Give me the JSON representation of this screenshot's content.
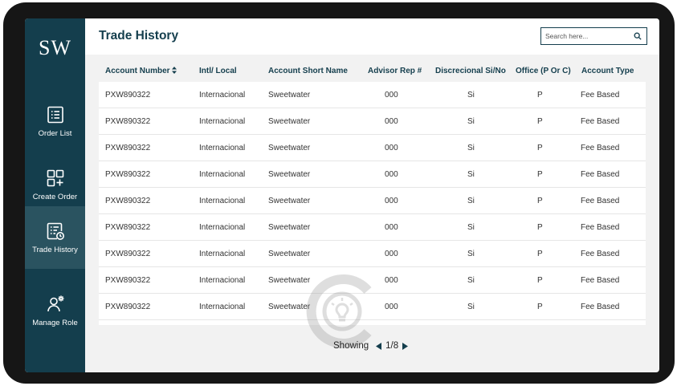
{
  "app": {
    "logo": "SW"
  },
  "sidebar": {
    "items": [
      {
        "label": "Order List",
        "icon": "list-icon",
        "active": false
      },
      {
        "label": "Create Order",
        "icon": "grid-plus-icon",
        "active": false
      },
      {
        "label": "Trade History",
        "icon": "history-list-icon",
        "active": true
      },
      {
        "label": "Manage Role",
        "icon": "user-gear-icon",
        "active": false
      }
    ]
  },
  "header": {
    "title": "Trade History",
    "search_placeholder": "Search here..."
  },
  "table": {
    "columns": [
      "Account Number",
      "Intl/ Local",
      "Account Short Name",
      "Advisor Rep #",
      "Discrecional Si/No",
      "Office (P Or C)",
      "Account Type"
    ],
    "rows": [
      [
        "PXW890322",
        "Internacional",
        "Sweetwater",
        "000",
        "Si",
        "P",
        "Fee Based"
      ],
      [
        "PXW890322",
        "Internacional",
        "Sweetwater",
        "000",
        "Si",
        "P",
        "Fee Based"
      ],
      [
        "PXW890322",
        "Internacional",
        "Sweetwater",
        "000",
        "Si",
        "P",
        "Fee Based"
      ],
      [
        "PXW890322",
        "Internacional",
        "Sweetwater",
        "000",
        "Si",
        "P",
        "Fee Based"
      ],
      [
        "PXW890322",
        "Internacional",
        "Sweetwater",
        "000",
        "Si",
        "P",
        "Fee Based"
      ],
      [
        "PXW890322",
        "Internacional",
        "Sweetwater",
        "000",
        "Si",
        "P",
        "Fee Based"
      ],
      [
        "PXW890322",
        "Internacional",
        "Sweetwater",
        "000",
        "Si",
        "P",
        "Fee Based"
      ],
      [
        "PXW890322",
        "Internacional",
        "Sweetwater",
        "000",
        "Si",
        "P",
        "Fee Based"
      ],
      [
        "PXW890322",
        "Internacional",
        "Sweetwater",
        "000",
        "Si",
        "P",
        "Fee Based"
      ]
    ]
  },
  "pagination": {
    "label": "Showing",
    "page": "1/8"
  },
  "colors": {
    "primary": "#143e4d",
    "active_nav": "#2a5360",
    "background": "#f2f2f2"
  }
}
